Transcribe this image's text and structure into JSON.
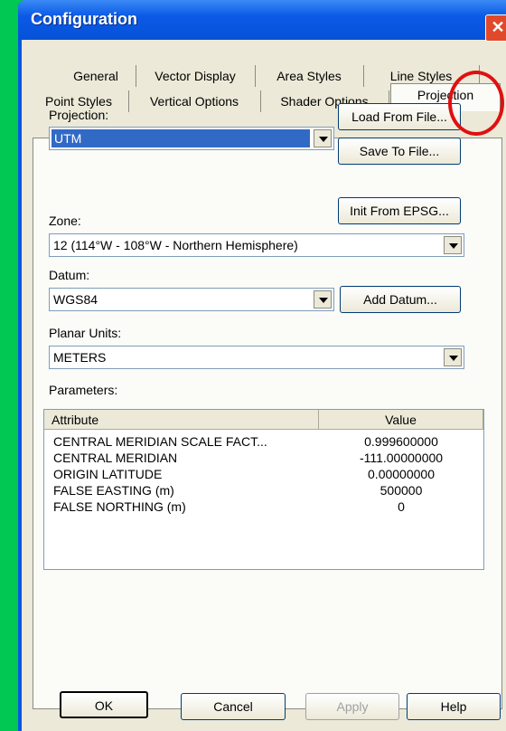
{
  "window": {
    "title": "Configuration"
  },
  "tabs_row1": [
    "General",
    "Vector Display",
    "Area Styles",
    "Line Styles"
  ],
  "tabs_row2": [
    "Point Styles",
    "Vertical Options",
    "Shader Options",
    "Projection"
  ],
  "projection": {
    "label": "Projection:",
    "value": "UTM",
    "load_button": "Load From File...",
    "save_button": "Save To File...",
    "epsg_button": "Init From EPSG..."
  },
  "zone": {
    "label": "Zone:",
    "value": "12 (114°W - 108°W - Northern Hemisphere)"
  },
  "datum": {
    "label": "Datum:",
    "value": "WGS84",
    "add_button": "Add Datum..."
  },
  "planar_units": {
    "label": "Planar Units:",
    "value": "METERS"
  },
  "parameters": {
    "label": "Parameters:",
    "columns": [
      "Attribute",
      "Value"
    ],
    "rows": [
      {
        "attribute": "CENTRAL MERIDIAN SCALE FACT...",
        "value": "0.999600000"
      },
      {
        "attribute": "CENTRAL MERIDIAN",
        "value": "-111.00000000"
      },
      {
        "attribute": "ORIGIN LATITUDE",
        "value": "0.00000000"
      },
      {
        "attribute": "FALSE EASTING (m)",
        "value": "500000"
      },
      {
        "attribute": "FALSE NORTHING (m)",
        "value": "0"
      }
    ]
  },
  "footer": {
    "ok": "OK",
    "cancel": "Cancel",
    "apply": "Apply",
    "help": "Help"
  }
}
